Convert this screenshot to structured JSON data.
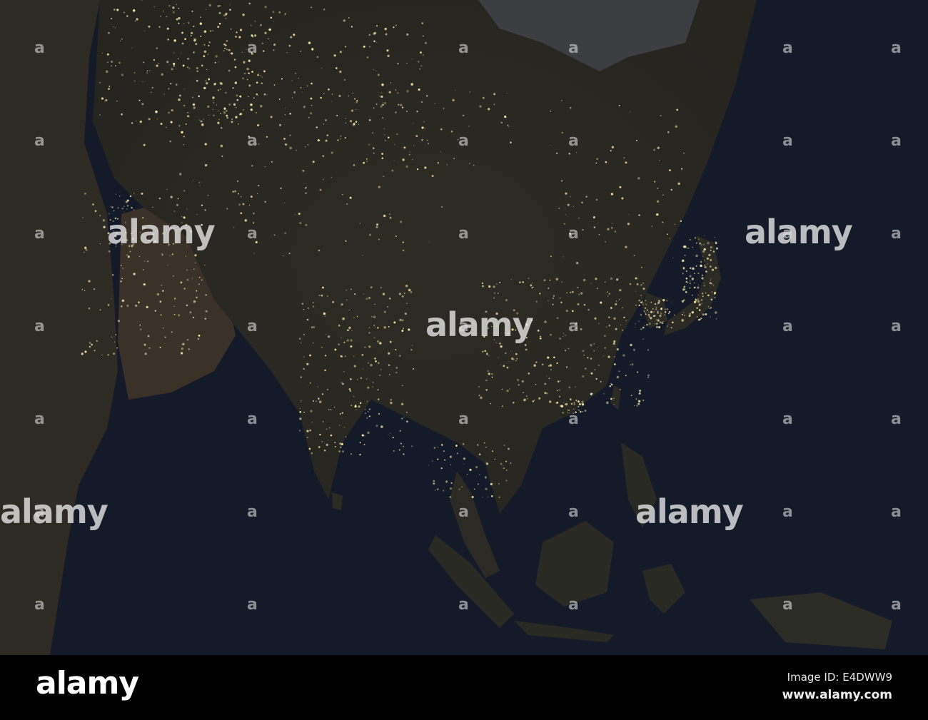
{
  "watermark": {
    "text": "alamy",
    "small_mark": "a"
  },
  "footer": {
    "logo": "alamy",
    "image_id": "Image ID: E4DWW9",
    "url": "www.alamy.com"
  },
  "colors": {
    "ocean": "#141a27",
    "land": "#2b2a24",
    "desert": "#3a3027",
    "snow": "#3c3e42",
    "lights": "#fff3b0"
  }
}
